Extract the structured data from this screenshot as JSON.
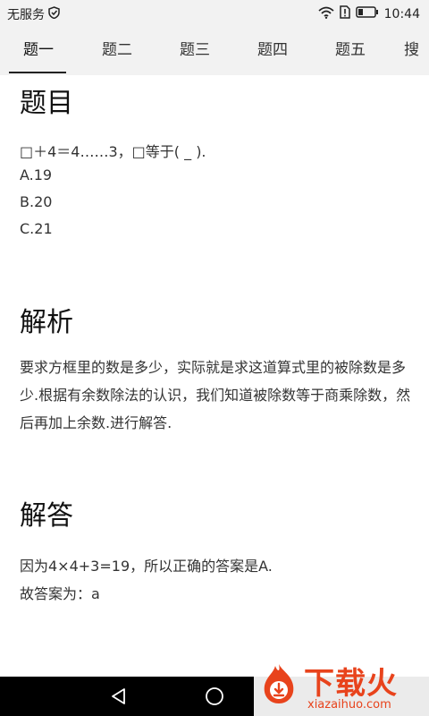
{
  "status_bar": {
    "carrier": "无服务",
    "time": "10:44"
  },
  "tabs": [
    {
      "label": "题一",
      "active": true
    },
    {
      "label": "题二",
      "active": false
    },
    {
      "label": "题三",
      "active": false
    },
    {
      "label": "题四",
      "active": false
    },
    {
      "label": "题五",
      "active": false
    },
    {
      "label": "搜",
      "active": false
    }
  ],
  "question": {
    "heading": "题目",
    "stem": "□＋4＝4……3，□等于( _ ).",
    "options": [
      "A.19",
      "B.20",
      "C.21"
    ]
  },
  "analysis": {
    "heading": "解析",
    "text": "要求方框里的数是多少，实际就是求这道算式里的被除数是多少.根据有余数除法的认识，我们知道被除数等于商乘除数，然后再加上余数.进行解答."
  },
  "answer": {
    "heading": "解答",
    "line1": "因为4×4+3=19，所以正确的答案是A.",
    "line2": "故答案为：a"
  },
  "watermark": {
    "brand": "下载火",
    "site": "xiazaihuo.com"
  },
  "colors": {
    "watermark": "#e8431c",
    "bar_background": "#f2f2f2"
  }
}
